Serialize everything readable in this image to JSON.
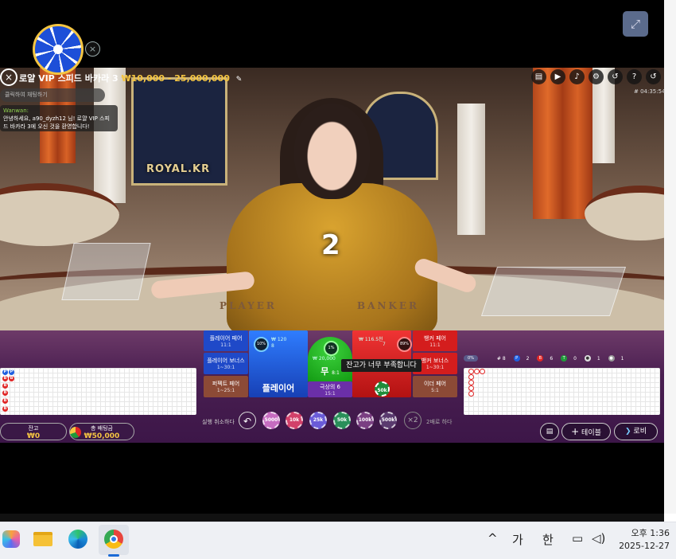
{
  "game": {
    "title": "로얄 VIP 스피드 바카라 3",
    "limit": "₩10,000 - 25,000,000",
    "timer": "# 04:35:54",
    "countdown": "2",
    "watermark": "ROYAL.KR",
    "felt_player": "PLAYER",
    "felt_banker": "BANKER"
  },
  "chat": {
    "placeholder": "클릭하여 채팅하기",
    "sender": "Wanwan:",
    "message": "안녕하세요, a90_dyzh12 님! 로얄 VIP 스피드 바카라 3에 오신 것을 환영합니다!"
  },
  "icons": {
    "close": "×",
    "pin": "✎",
    "chat": "▤",
    "video": "▶",
    "sound": "♪",
    "settings": "⚙",
    "history": "↺",
    "help": "?",
    "wheel_close": "×",
    "fullscreen": "⤢",
    "undo": "↶",
    "add": "+",
    "lobby": "❯"
  },
  "bets": {
    "player_pair": {
      "label": "플레이어 페어",
      "odds": "11:1"
    },
    "player_bonus": {
      "label": "플레이어 보너스",
      "odds": "1~30:1"
    },
    "perfect_pair": {
      "label": "퍼펙트 페어",
      "odds": "1~25:1"
    },
    "player": {
      "label": "플레이어",
      "stake": "₩ 120",
      "count": "8",
      "pct": "10%"
    },
    "tie": {
      "label": "무",
      "odds": "8:1",
      "stake": "₩ 20,000",
      "count": "1",
      "pct": "1%"
    },
    "banker": {
      "stake": "₩ 116.5천",
      "count": "7",
      "pct": "89%"
    },
    "banker_pair": {
      "label": "뱅커 페어",
      "odds": "11:1"
    },
    "banker_bonus": {
      "label": "뱅커 보너스",
      "odds": "1~30:1"
    },
    "either_pair": {
      "label": "이더 페어",
      "odds": "5:1"
    },
    "super6": {
      "label": "극상의 6",
      "odds": "15:1"
    },
    "placed_chip": "50k"
  },
  "tooltip": "잔고가 너무 부족합니다",
  "stats": {
    "pct": "0%",
    "total": "# 8",
    "player": "2",
    "banker": "6",
    "tie": "0",
    "pp": "1",
    "bp": "1"
  },
  "balance": {
    "label": "잔고",
    "value": "₩0"
  },
  "total_bet": {
    "label": "총 배팅금",
    "value": "₩50,000"
  },
  "controls": {
    "undo_label": "실행 취소하다",
    "double_label": "2배로 하다",
    "x2": "×2",
    "chips": [
      "5000",
      "10k",
      "25k",
      "50k",
      "100k",
      "500k"
    ],
    "table_btn": "테이블",
    "lobby_btn": "로비"
  },
  "bead_road": [
    "P",
    "P",
    "B",
    "B",
    "B",
    "B",
    "B",
    "B"
  ],
  "big_road": [
    "B",
    "B",
    "B",
    "B",
    "B",
    "B"
  ],
  "taskbar": {
    "ime1": "가",
    "ime2": "한",
    "time": "오후 1:36",
    "date": "2025-12-27"
  }
}
